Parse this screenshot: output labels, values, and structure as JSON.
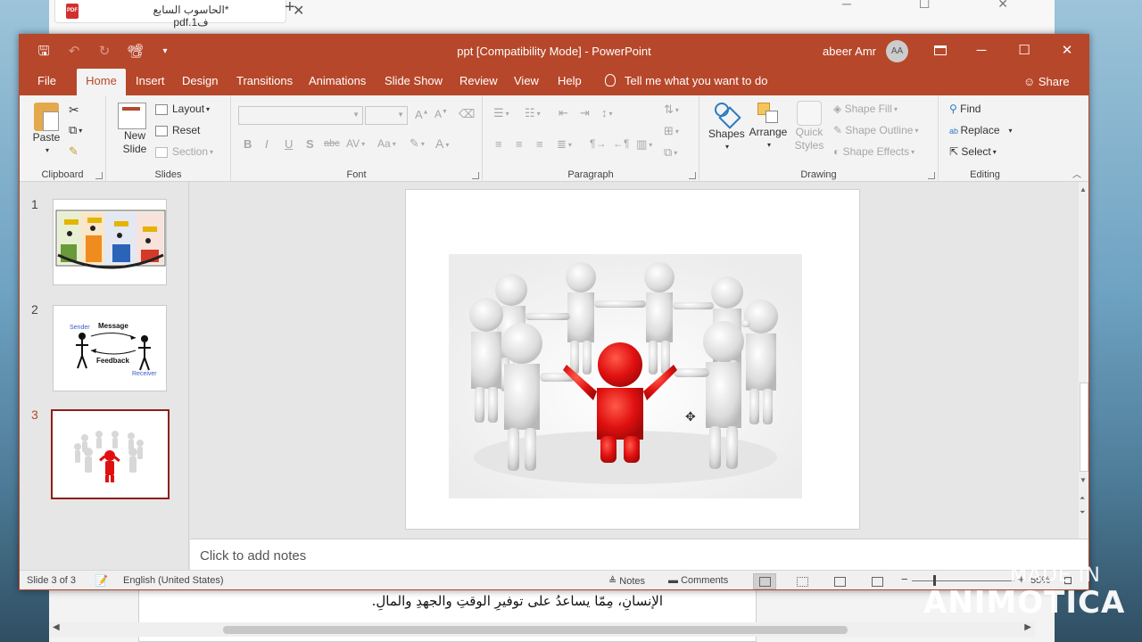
{
  "background_window": {
    "tab_title": "*الحاسوب السابع ف1.pdf",
    "page_text": "الإنسانِ، مِمّا يساعدُ على توفيرِ الوقتِ والجهدِ والمالِ."
  },
  "titlebar": {
    "title": "ppt [Compatibility Mode]  -  PowerPoint",
    "user_name": "abeer Amr",
    "user_initials": "AA"
  },
  "tabs": [
    {
      "label": "File"
    },
    {
      "label": "Home"
    },
    {
      "label": "Insert"
    },
    {
      "label": "Design"
    },
    {
      "label": "Transitions"
    },
    {
      "label": "Animations"
    },
    {
      "label": "Slide Show"
    },
    {
      "label": "Review"
    },
    {
      "label": "View"
    },
    {
      "label": "Help"
    }
  ],
  "tell_me": "Tell me what you want to do",
  "share": "Share",
  "ribbon": {
    "clipboard": {
      "paste": "Paste",
      "label": "Clipboard"
    },
    "slides": {
      "new_slide": "New Slide",
      "layout": "Layout",
      "reset": "Reset",
      "section": "Section",
      "label": "Slides"
    },
    "font": {
      "label": "Font",
      "bold": "B",
      "italic": "I",
      "underline": "U",
      "shadow": "S",
      "strike": "abc",
      "spacing": "AV",
      "case": "Aa",
      "color": "A"
    },
    "paragraph": {
      "label": "Paragraph"
    },
    "drawing": {
      "shapes": "Shapes",
      "arrange": "Arrange",
      "quick_styles": "Quick Styles",
      "shape_fill": "Shape Fill",
      "shape_outline": "Shape Outline",
      "shape_effects": "Shape Effects",
      "label": "Drawing"
    },
    "editing": {
      "find": "Find",
      "replace": "Replace",
      "select": "Select",
      "label": "Editing"
    }
  },
  "thumbnails": [
    {
      "num": "1",
      "selected": false
    },
    {
      "num": "2",
      "selected": false,
      "sender": "Sender",
      "message": "Message",
      "feedback": "Feedback",
      "receiver": "Receiver"
    },
    {
      "num": "3",
      "selected": true
    }
  ],
  "notes_placeholder": "Click to add notes",
  "status": {
    "slide": "Slide 3 of 3",
    "language": "English (United States)",
    "notes": "Notes",
    "comments": "Comments",
    "zoom": "55%"
  },
  "watermark": {
    "line1": "MADE IN",
    "line2": "ANIMOTICA"
  },
  "colors": {
    "accent": "#b7472a",
    "figure_red": "#e01010"
  }
}
